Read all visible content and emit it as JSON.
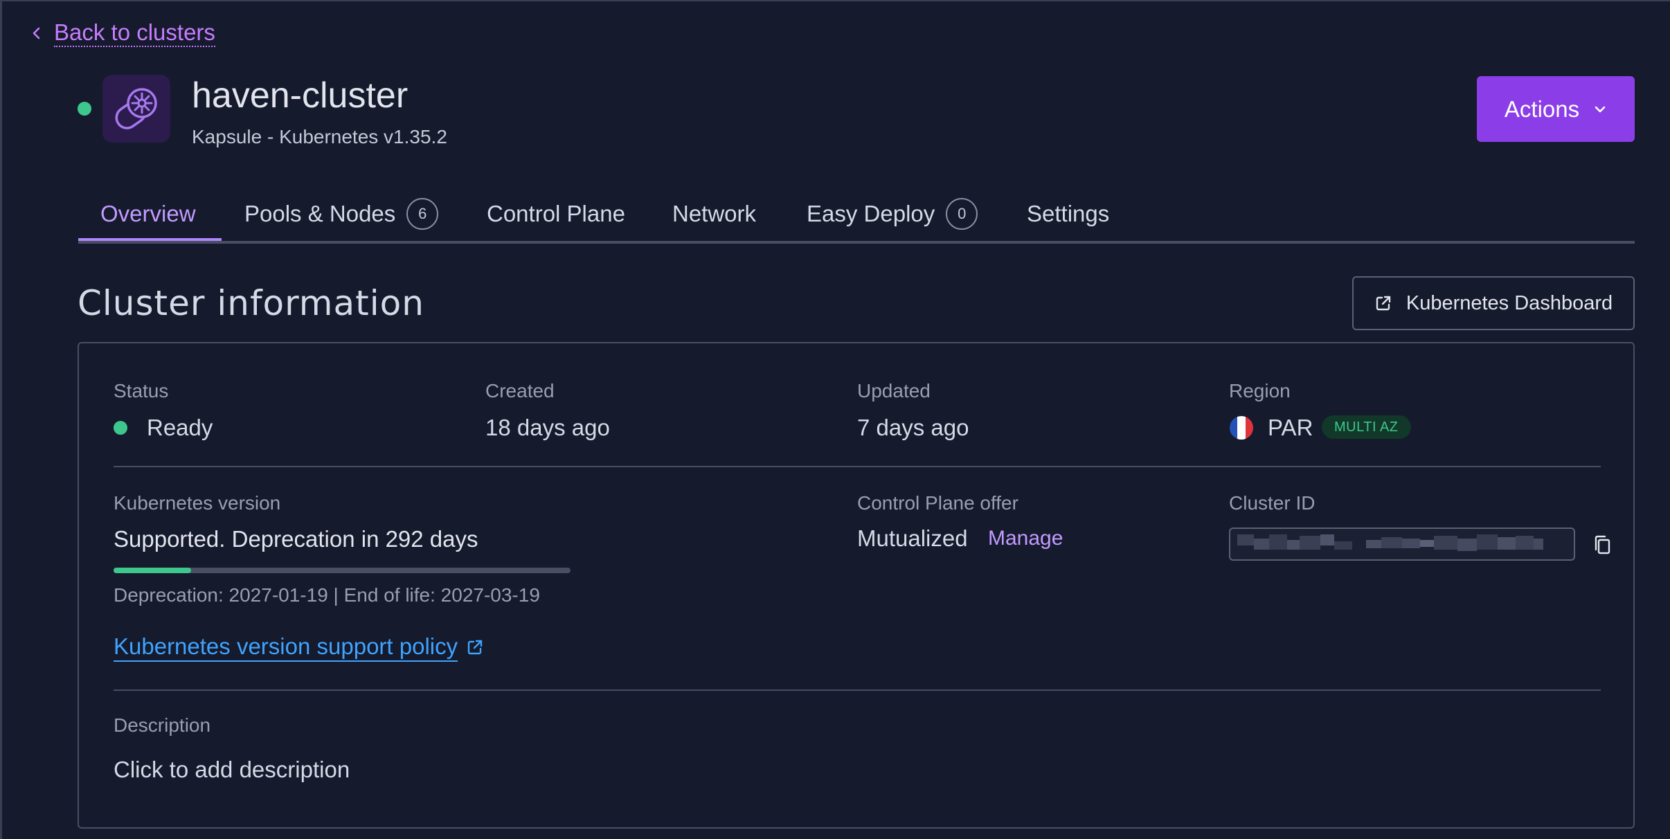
{
  "nav": {
    "back_label": "Back to clusters"
  },
  "header": {
    "cluster_name": "haven-cluster",
    "subtitle": "Kapsule - Kubernetes v1.35.2",
    "actions_label": "Actions",
    "status_color": "#3ec78d",
    "icon": "kubernetes-helm-icon"
  },
  "tabs": [
    {
      "label": "Overview",
      "active": true
    },
    {
      "label": "Pools & Nodes",
      "count": "6"
    },
    {
      "label": "Control Plane"
    },
    {
      "label": "Network"
    },
    {
      "label": "Easy Deploy",
      "count": "0"
    },
    {
      "label": "Settings"
    }
  ],
  "section": {
    "title": "Cluster information",
    "dashboard_button": "Kubernetes Dashboard"
  },
  "info": {
    "status_label": "Status",
    "status_value": "Ready",
    "created_label": "Created",
    "created_value": "18 days ago",
    "updated_label": "Updated",
    "updated_value": "7 days ago",
    "region_label": "Region",
    "region_value": "PAR",
    "region_badge": "MULTI AZ",
    "k8s_version_label": "Kubernetes version",
    "k8s_version_value": "Supported. Deprecation in 292 days",
    "support_progress": 0.17,
    "dates": "Deprecation: 2027-01-19 | End of life: 2027-03-19",
    "policy_link": "Kubernetes version support policy",
    "control_plane_label": "Control Plane offer",
    "control_plane_value": "Mutualized",
    "manage_label": "Manage",
    "cluster_id_label": "Cluster ID",
    "description_label": "Description",
    "description_value": "Click to add description"
  },
  "colors": {
    "background": "#151a2c",
    "accent": "#8b3ee8",
    "link_purple": "#c77dff",
    "success": "#3ec78d",
    "link_blue": "#3fa3ff"
  }
}
